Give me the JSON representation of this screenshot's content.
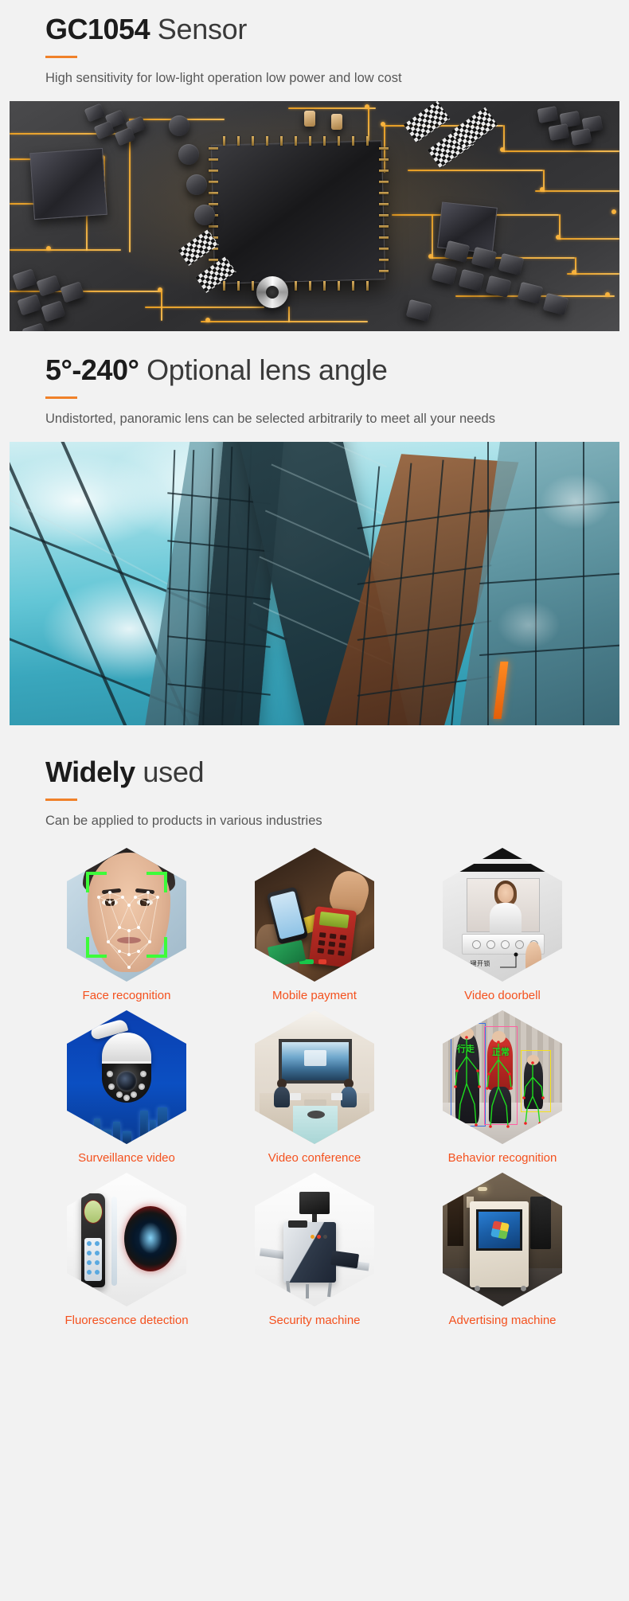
{
  "sections": [
    {
      "id": "sensor",
      "heading_strong": "GC1054",
      "heading_light": " Sensor",
      "subtitle": "High sensitivity for low-light operation low power and low cost",
      "image_alt": "printed-circuit-board-with-sensor-chip"
    },
    {
      "id": "lens",
      "heading_strong": "5°-240°",
      "heading_light": " Optional lens angle",
      "subtitle": "Undistorted, panoramic lens can be selected arbitrarily to meet all your needs",
      "image_alt": "glass-skyscrapers-wide-angle"
    },
    {
      "id": "applications",
      "heading_strong": "Widely",
      "heading_light": " used",
      "subtitle": "Can be applied to products in various industries"
    }
  ],
  "applications": {
    "items": [
      {
        "label": "Face recognition",
        "icon": "face-recognition-icon"
      },
      {
        "label": "Mobile payment",
        "icon": "mobile-payment-icon"
      },
      {
        "label": "Video doorbell",
        "icon": "video-doorbell-icon"
      },
      {
        "label": "Surveillance video",
        "icon": "surveillance-camera-icon"
      },
      {
        "label": "Video conference",
        "icon": "video-conference-icon"
      },
      {
        "label": "Behavior recognition",
        "icon": "behavior-recognition-icon"
      },
      {
        "label": "Fluorescence detection",
        "icon": "fluorescence-detector-icon"
      },
      {
        "label": "Security machine",
        "icon": "security-scanner-icon"
      },
      {
        "label": "Advertising machine",
        "icon": "advertising-kiosk-icon"
      }
    ]
  },
  "doorbell": {
    "caption": "一键开锁"
  },
  "behavior": {
    "tag_left": "行走",
    "tag_right": "正常"
  },
  "colors": {
    "accent": "#f08129",
    "label": "#f4511e",
    "heading_strong": "#1c1c1c",
    "heading_light": "#3a3a3a",
    "subtitle": "#585858",
    "page_background": "#f2f2f2"
  }
}
